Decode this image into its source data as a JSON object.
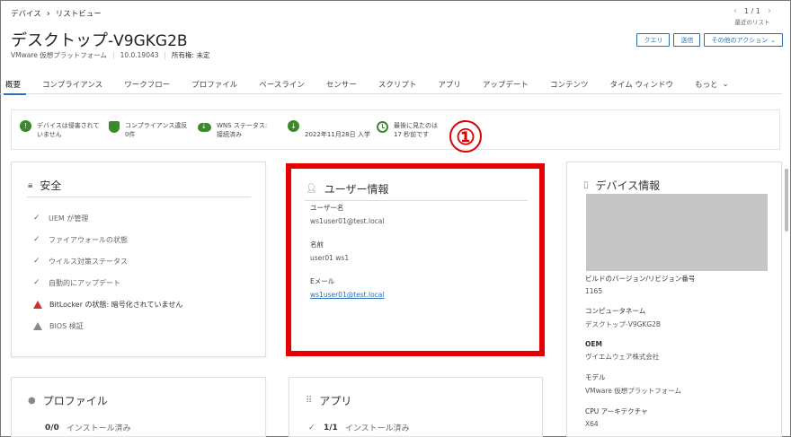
{
  "breadcrumb": {
    "root": "デバイス",
    "current": "リストビュー"
  },
  "pager": {
    "position": "1 / 1",
    "recent": "最近のリスト"
  },
  "title": {
    "prefix": "デスクトップ",
    "name": "-V9GKG2B"
  },
  "subinfo": {
    "platform": "VMware 仮想プラットフォーム",
    "version": "10.0.19043",
    "ownership": "所有権: 未定"
  },
  "actions": {
    "query": "クエリ",
    "send": "送信",
    "more": "その他のアクション"
  },
  "tabs": [
    "概要",
    "コンプライアンス",
    "ワークフロー",
    "プロファイル",
    "ベースライン",
    "センサー",
    "スクリプト",
    "アプリ",
    "アップデート",
    "コンテンツ",
    "タイム ウィンドウ",
    "もっと"
  ],
  "status": [
    {
      "line1": "デバイスは侵害されて",
      "line2": "いません"
    },
    {
      "line1": "コンプライアンス違反",
      "line2": "0件"
    },
    {
      "line1": "WNS ステータス:",
      "line2": "接続済み"
    },
    {
      "line1": "2022年11月28日 入学",
      "line2": ""
    },
    {
      "line1": "最後に見たのは",
      "line2": "17 秒前です"
    }
  ],
  "annotation": {
    "number": "①"
  },
  "security": {
    "title": "安全",
    "items": [
      {
        "label": "UEM が管理",
        "state": "ok"
      },
      {
        "label": "ファイアウォールの状態",
        "state": "ok"
      },
      {
        "label": "ウイルス対策ステータス",
        "state": "ok"
      },
      {
        "label": "自動的にアップデート",
        "state": "ok"
      },
      {
        "label": "BitLocker の状態: 暗号化されていません",
        "state": "error"
      },
      {
        "label": "BIOS 検証",
        "state": "unknown"
      }
    ]
  },
  "user": {
    "title": "ユーザー情報",
    "username_label": "ユーザー名",
    "username": "ws1user01@test.local",
    "name_label": "名前",
    "name": "user01 ws1",
    "email_label": "Eメール",
    "email": "ws1user01@test.local"
  },
  "device": {
    "title": "デバイス情報",
    "build_label": "ビルドのバージョン/リビジョン番号",
    "build": "1165",
    "computer_label": "コンピュータネーム",
    "computer": "デスクトップ-V9GKG2B",
    "oem_label": "OEM",
    "oem": "ヴイエムウェア株式会社",
    "model_label": "モデル",
    "model": "VMware 仮想プラットフォーム",
    "cpu_label": "CPU アーキテクチャ",
    "cpu": "X64"
  },
  "profile": {
    "title": "プロファイル",
    "count": "0/0",
    "text": "インストール済み"
  },
  "apps": {
    "title": "アプリ",
    "count": "1/1",
    "text": "インストール済み"
  }
}
